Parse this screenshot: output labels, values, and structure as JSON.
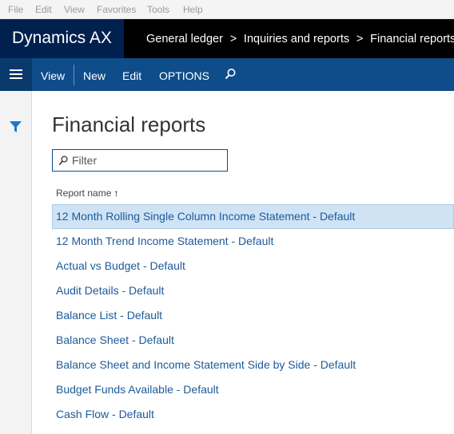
{
  "browser_menu": [
    "File",
    "Edit",
    "View",
    "Favorites",
    "Tools",
    "Help"
  ],
  "app": {
    "title": "Dynamics AX"
  },
  "breadcrumb": [
    "General ledger",
    "Inquiries and reports",
    "Financial reports"
  ],
  "breadcrumb_sep": ">",
  "actions": {
    "view": "View",
    "new": "New",
    "edit": "Edit",
    "options": "OPTIONS"
  },
  "page": {
    "title": "Financial reports"
  },
  "filter": {
    "placeholder": "Filter",
    "value": ""
  },
  "grid": {
    "column_header": "Report name",
    "sort_indicator": "↑",
    "rows": [
      "12 Month Rolling Single Column Income Statement - Default",
      "12 Month Trend  Income Statement - Default",
      "Actual vs Budget - Default",
      "Audit Details - Default",
      "Balance List - Default",
      "Balance Sheet - Default",
      "Balance Sheet and Income Statement Side by Side - Default",
      "Budget Funds Available - Default",
      "Cash Flow - Default"
    ],
    "selected_index": 0
  },
  "colors": {
    "brand": "#002050",
    "action_pane": "#0f4c8a",
    "link": "#1d5a9a",
    "selected_row": "#cfe3f5"
  },
  "icons": {
    "nav": "hamburger-icon",
    "search": "search-icon",
    "filter_pane": "filter-icon",
    "filter_input": "search-icon"
  }
}
